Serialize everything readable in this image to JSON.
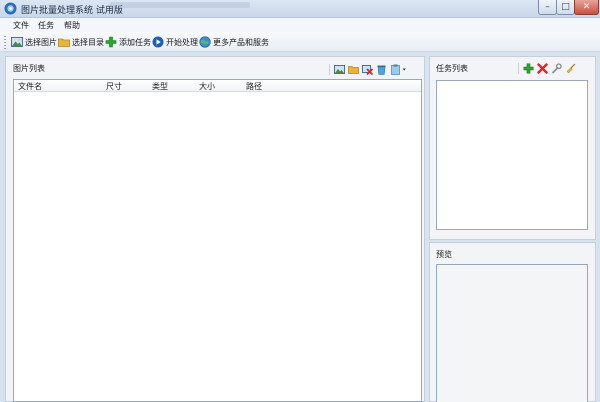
{
  "window": {
    "title": "图片批量处理系统 试用版",
    "controls": {
      "minimize": "–",
      "maximize": "□",
      "close": "✕"
    }
  },
  "menu": [
    "文件",
    "任务",
    "帮助"
  ],
  "toolbar": {
    "select_image": "选择图片",
    "select_folder": "选择目录",
    "add_task": "添加任务",
    "start_process": "开始处理",
    "more_products": "更多产品和服务"
  },
  "image_list": {
    "title": "图片列表",
    "columns": [
      "文件名",
      "尺寸",
      "类型",
      "大小",
      "路径"
    ],
    "rows": []
  },
  "task_list": {
    "title": "任务列表",
    "items": []
  },
  "preview": {
    "title": "预览"
  },
  "colors": {
    "add_green": "#2aa52a",
    "delete_red": "#d22a2a",
    "folder_yellow": "#e8b53a",
    "start_blue": "#1f5fae"
  }
}
